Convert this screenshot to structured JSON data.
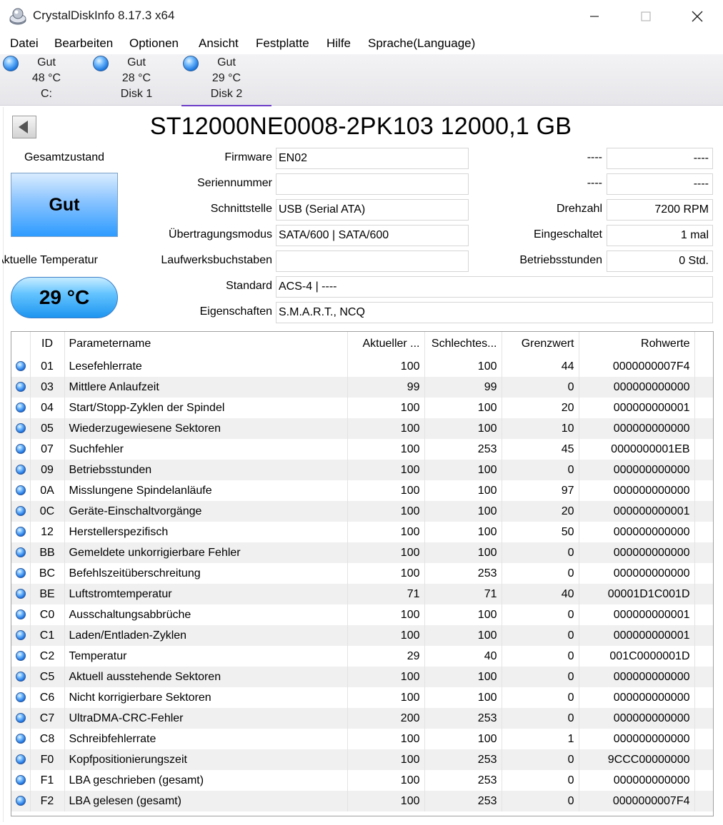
{
  "window": {
    "title": "CrystalDiskInfo 8.17.3 x64",
    "app_icon": "crystaldiskinfo-icon"
  },
  "menu": [
    "Datei",
    "Bearbeiten",
    "Optionen",
    "Ansicht",
    "Festplatte",
    "Hilfe",
    "Sprache(Language)"
  ],
  "disk_tabs": [
    {
      "status": "Gut",
      "temp": "48 °C",
      "name": "C:",
      "active": false
    },
    {
      "status": "Gut",
      "temp": "28 °C",
      "name": "Disk 1",
      "active": false
    },
    {
      "status": "Gut",
      "temp": "29 °C",
      "name": "Disk 2",
      "active": true
    }
  ],
  "drive": {
    "title": "ST12000NE0008-2PK103 12000,1 GB",
    "health_label": "Gesamtzustand",
    "health_value": "Gut",
    "temp_label": "Aktuelle Temperatur",
    "temp_value": "29 °C",
    "fields": {
      "firmware_label": "Firmware",
      "firmware": "EN02",
      "serial_label": "Seriennummer",
      "serial": "",
      "interface_label": "Schnittstelle",
      "interface": "USB (Serial ATA)",
      "transfer_label": "Übertragungsmodus",
      "transfer": "SATA/600 | SATA/600",
      "letters_label": "Laufwerksbuchstaben",
      "letters": "",
      "standard_label": "Standard",
      "standard": "ACS-4 | ----",
      "features_label": "Eigenschaften",
      "features": "S.M.A.R.T., NCQ",
      "r1_label": "----",
      "r1": "----",
      "r2_label": "----",
      "r2": "----",
      "rpm_label": "Drehzahl",
      "rpm": "7200 RPM",
      "power_on_count_label": "Eingeschaltet",
      "power_on_count": "1 mal",
      "power_on_hours_label": "Betriebsstunden",
      "power_on_hours": "0 Std."
    }
  },
  "smart": {
    "headers": [
      "",
      "ID",
      "Parametername",
      "Aktueller ...",
      "Schlechtes...",
      "Grenzwert",
      "Rohwerte"
    ],
    "rows": [
      [
        "01",
        "Lesefehlerrate",
        "100",
        "100",
        "44",
        "0000000007F4"
      ],
      [
        "03",
        "Mittlere Anlaufzeit",
        "99",
        "99",
        "0",
        "000000000000"
      ],
      [
        "04",
        "Start/Stopp-Zyklen der Spindel",
        "100",
        "100",
        "20",
        "000000000001"
      ],
      [
        "05",
        "Wiederzugewiesene Sektoren",
        "100",
        "100",
        "10",
        "000000000000"
      ],
      [
        "07",
        "Suchfehler",
        "100",
        "253",
        "45",
        "0000000001EB"
      ],
      [
        "09",
        "Betriebsstunden",
        "100",
        "100",
        "0",
        "000000000000"
      ],
      [
        "0A",
        "Misslungene Spindelanläufe",
        "100",
        "100",
        "97",
        "000000000000"
      ],
      [
        "0C",
        "Geräte-Einschaltvorgänge",
        "100",
        "100",
        "20",
        "000000000001"
      ],
      [
        "12",
        "Herstellerspezifisch",
        "100",
        "100",
        "50",
        "000000000000"
      ],
      [
        "BB",
        "Gemeldete unkorrigierbare Fehler",
        "100",
        "100",
        "0",
        "000000000000"
      ],
      [
        "BC",
        "Befehlszeitüberschreitung",
        "100",
        "253",
        "0",
        "000000000000"
      ],
      [
        "BE",
        "Luftstromtemperatur",
        "71",
        "71",
        "40",
        "00001D1C001D"
      ],
      [
        "C0",
        "Ausschaltungsabbrüche",
        "100",
        "100",
        "0",
        "000000000001"
      ],
      [
        "C1",
        "Laden/Entladen-Zyklen",
        "100",
        "100",
        "0",
        "000000000001"
      ],
      [
        "C2",
        "Temperatur",
        "29",
        "40",
        "0",
        "001C0000001D"
      ],
      [
        "C5",
        "Aktuell ausstehende Sektoren",
        "100",
        "100",
        "0",
        "000000000000"
      ],
      [
        "C6",
        "Nicht korrigierbare Sektoren",
        "100",
        "100",
        "0",
        "000000000000"
      ],
      [
        "C7",
        "UltraDMA-CRC-Fehler",
        "200",
        "253",
        "0",
        "000000000000"
      ],
      [
        "C8",
        "Schreibfehlerrate",
        "100",
        "100",
        "1",
        "000000000000"
      ],
      [
        "F0",
        "Kopfpositionierungszeit",
        "100",
        "253",
        "0",
        "9CCC00000000"
      ],
      [
        "F1",
        "LBA geschrieben (gesamt)",
        "100",
        "253",
        "0",
        "000000000000"
      ],
      [
        "F2",
        "LBA gelesen (gesamt)",
        "100",
        "253",
        "0",
        "0000000007F4"
      ]
    ]
  }
}
